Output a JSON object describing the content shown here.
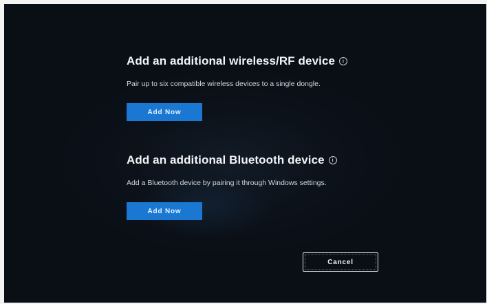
{
  "rf_section": {
    "title": "Add an additional wireless/RF device",
    "info_icon": "info-circle-icon",
    "description": "Pair up to six compatible wireless devices to a single dongle.",
    "button_label": "Add Now"
  },
  "bt_section": {
    "title": "Add an additional Bluetooth device",
    "info_icon": "info-circle-icon",
    "description": "Add a Bluetooth device by pairing it through Windows settings.",
    "button_label": "Add Now"
  },
  "footer": {
    "cancel_label": "Cancel"
  },
  "colors": {
    "background": "#0a0f16",
    "accent": "#1a78d2",
    "text": "#f2f4f7"
  }
}
